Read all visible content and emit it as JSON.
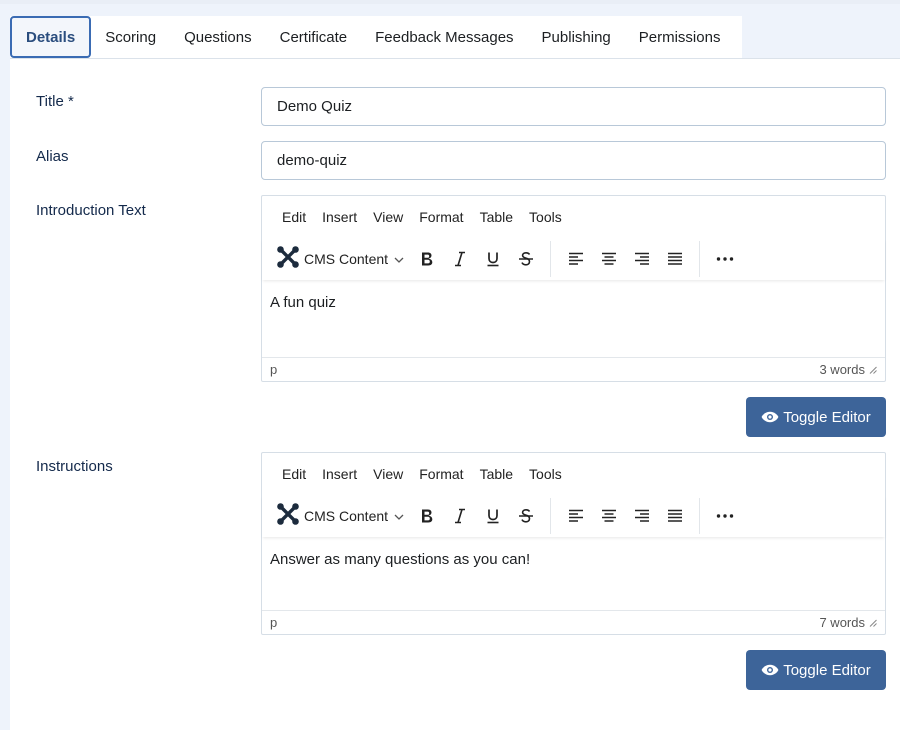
{
  "tabs": [
    {
      "label": "Details",
      "active": true
    },
    {
      "label": "Scoring"
    },
    {
      "label": "Questions"
    },
    {
      "label": "Certificate"
    },
    {
      "label": "Feedback Messages"
    },
    {
      "label": "Publishing"
    },
    {
      "label": "Permissions"
    }
  ],
  "form": {
    "title": {
      "label": "Title *",
      "value": "Demo Quiz"
    },
    "alias": {
      "label": "Alias",
      "value": "demo-quiz"
    },
    "introduction": {
      "label": "Introduction Text",
      "menu": [
        "Edit",
        "Insert",
        "View",
        "Format",
        "Table",
        "Tools"
      ],
      "format_select": "CMS Content",
      "content": "A fun quiz",
      "path": "p",
      "word_count": "3 words",
      "toggle_label": "Toggle Editor"
    },
    "instructions": {
      "label": "Instructions",
      "menu": [
        "Edit",
        "Insert",
        "View",
        "Format",
        "Table",
        "Tools"
      ],
      "format_select": "CMS Content",
      "content": "Answer as many questions as you can!",
      "path": "p",
      "word_count": "7 words",
      "toggle_label": "Toggle Editor"
    }
  },
  "colors": {
    "active_tab_border": "#3a6bb3",
    "label_text": "#13294b",
    "toggle_button": "#3d6499"
  },
  "icons": {
    "cms_logo": "joomla-icon",
    "bold": "bold-icon",
    "italic": "italic-icon",
    "underline": "underline-icon",
    "strike": "strikethrough-icon",
    "align_left": "align-left-icon",
    "align_center": "align-center-icon",
    "align_right": "align-right-icon",
    "justify": "align-justify-icon",
    "more": "more-icon",
    "eye": "eye-icon"
  }
}
